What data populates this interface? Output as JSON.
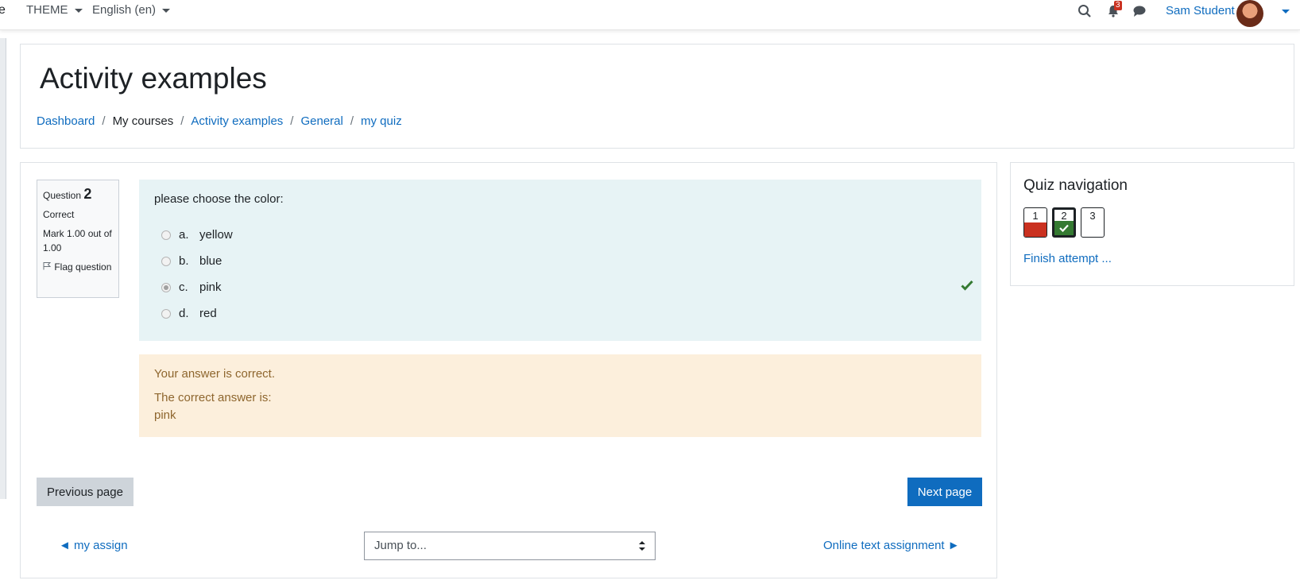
{
  "navbar": {
    "cut_text": "e",
    "theme_menu": "THEME",
    "language_menu": "English (en)",
    "notification_count": "3",
    "user_name": "Sam Student"
  },
  "header": {
    "title": "Activity examples",
    "breadcrumb": {
      "dashboard": "Dashboard",
      "my_courses": "My courses",
      "course": "Activity examples",
      "section": "General",
      "activity": "my quiz",
      "separator": "/"
    }
  },
  "question": {
    "label": "Question",
    "number": "2",
    "status": "Correct",
    "mark": "Mark 1.00 out of 1.00",
    "flag_label": "Flag question",
    "text": "please choose the color:",
    "answers": [
      {
        "letter": "a.",
        "text": "yellow",
        "selected": false
      },
      {
        "letter": "b.",
        "text": "blue",
        "selected": false
      },
      {
        "letter": "c.",
        "text": "pink",
        "selected": true
      },
      {
        "letter": "d.",
        "text": "red",
        "selected": false
      }
    ],
    "feedback": "Your answer is correct.",
    "right_answer_label": "The correct answer is:",
    "right_answer_value": "pink"
  },
  "navigation": {
    "previous_page": "Previous page",
    "next_page": "Next page",
    "prev_activity": "◄ my assign",
    "jump_to": "Jump to...",
    "next_activity": "Online text assignment ►"
  },
  "quiz_nav": {
    "title": "Quiz navigation",
    "buttons": [
      "1",
      "2",
      "3"
    ],
    "finish": "Finish attempt ..."
  },
  "colors": {
    "link": "#0f6cbf",
    "correct": "#357a32",
    "incorrect": "#ca3120",
    "question_bg": "#e7f3f5",
    "feedback_bg": "#fcefdc"
  }
}
